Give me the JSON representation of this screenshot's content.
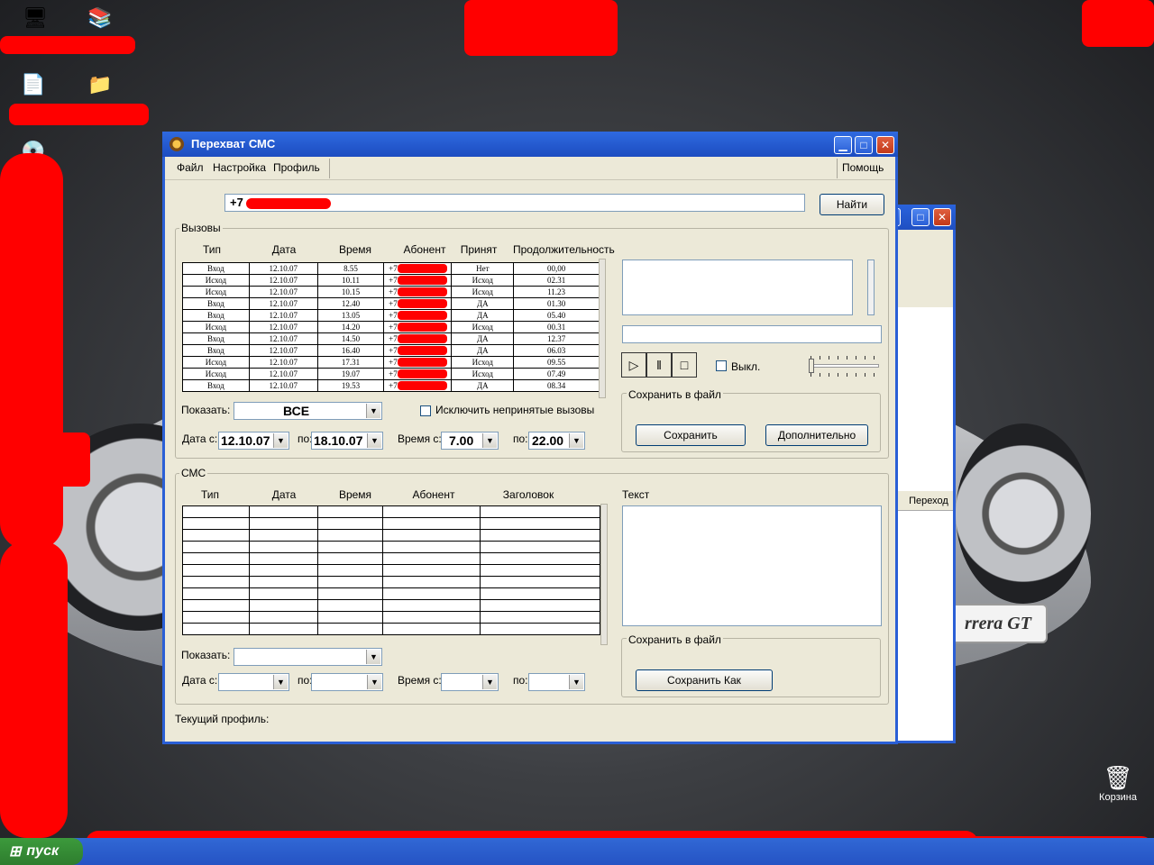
{
  "desktop": {
    "recycle_bin_label": "Корзина",
    "start_label": "пуск",
    "car_badge": "rrera GT"
  },
  "back_window": {
    "column_label": "Переход"
  },
  "window": {
    "title": "Перехват СМС",
    "menu": [
      "Файл",
      "Настройка",
      "Профиль"
    ],
    "help_menu": "Помощь",
    "search_value": "+7",
    "find_button": "Найти"
  },
  "calls": {
    "group_label": "Вызовы",
    "columns": [
      "Тип",
      "Дата",
      "Время",
      "Абонент",
      "Принят",
      "Продолжительность"
    ],
    "rows": [
      {
        "type": "Вход",
        "date": "12.10.07",
        "time": "8.55",
        "subscriber": "+7",
        "accepted": "Нет",
        "duration": "00,00"
      },
      {
        "type": "Исход",
        "date": "12.10.07",
        "time": "10.11",
        "subscriber": "+7",
        "accepted": "Исход",
        "duration": "02.31"
      },
      {
        "type": "Исход",
        "date": "12.10.07",
        "time": "10.15",
        "subscriber": "+7",
        "accepted": "Исход",
        "duration": "11.23"
      },
      {
        "type": "Вход",
        "date": "12.10.07",
        "time": "12.40",
        "subscriber": "+7",
        "accepted": "ДА",
        "duration": "01.30"
      },
      {
        "type": "Вход",
        "date": "12.10.07",
        "time": "13.05",
        "subscriber": "+7",
        "accepted": "ДА",
        "duration": "05.40"
      },
      {
        "type": "Исход",
        "date": "12.10.07",
        "time": "14.20",
        "subscriber": "+7",
        "accepted": "Исход",
        "duration": "00.31"
      },
      {
        "type": "Вход",
        "date": "12.10.07",
        "time": "14.50",
        "subscriber": "+7",
        "accepted": "ДА",
        "duration": "12.37"
      },
      {
        "type": "Вход",
        "date": "12.10.07",
        "time": "16.40",
        "subscriber": "+7",
        "accepted": "ДА",
        "duration": "06.03"
      },
      {
        "type": "Исход",
        "date": "12.10.07",
        "time": "17.31",
        "subscriber": "+7",
        "accepted": "Исход",
        "duration": "09.55"
      },
      {
        "type": "Исход",
        "date": "12.10.07",
        "time": "19.07",
        "subscriber": "+7",
        "accepted": "Исход",
        "duration": "07.49"
      },
      {
        "type": "Вход",
        "date": "12.10.07",
        "time": "19.53",
        "subscriber": "+7",
        "accepted": "ДА",
        "duration": "08.34"
      }
    ],
    "show_label": "Показать:",
    "show_value": "ВСЕ",
    "exclude_label": "Исключить непринятые вызовы",
    "date_from_label": "Дата с:",
    "date_from": "12.10.07",
    "to_label": "по:",
    "date_to": "18.10.07",
    "time_from_label": "Время с:",
    "time_from": "7.00",
    "time_to": "22.00",
    "off_label": "Выкл.",
    "save_group_label": "Сохранить в файл",
    "save_button": "Сохранить",
    "more_button": "Дополнительно"
  },
  "sms": {
    "group_label": "СМС",
    "columns": [
      "Тип",
      "Дата",
      "Время",
      "Абонент",
      "Заголовок"
    ],
    "empty_rows": 11,
    "text_label": "Текст",
    "show_label": "Показать:",
    "date_from_label": "Дата с:",
    "to_label": "по:",
    "time_from_label": "Время с:",
    "save_group_label": "Сохранить в файл",
    "save_as_button": "Сохранить Как"
  },
  "status": {
    "profile_label": "Текущий профиль:"
  }
}
